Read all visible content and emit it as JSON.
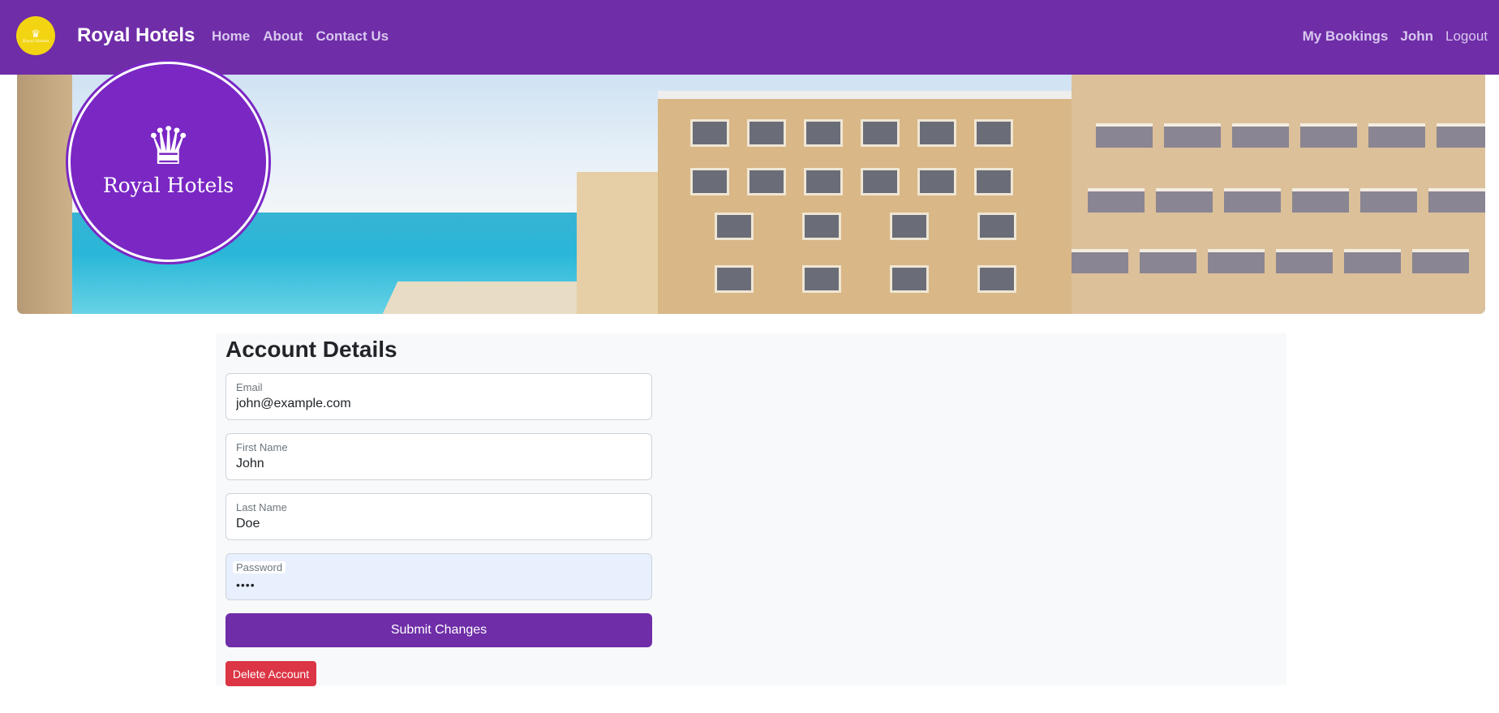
{
  "navbar": {
    "brand_name": "Royal Hotels",
    "logo_icon": "crown-icon",
    "logo_text": "Royal Hotels",
    "left_links": [
      "Home",
      "About",
      "Contact Us"
    ],
    "right_links": [
      "My Bookings",
      "John",
      "Logout"
    ],
    "background_color": "#6f2da8",
    "logo_color": "#f2d413"
  },
  "hero": {
    "emblem_icon": "crown-icon",
    "emblem_text": "Royal Hotels",
    "emblem_color": "#7a27c4"
  },
  "account": {
    "title": "Account Details",
    "fields": [
      {
        "label": "Email",
        "value": "john@example.com",
        "type": "email"
      },
      {
        "label": "First Name",
        "value": "John",
        "type": "text"
      },
      {
        "label": "Last Name",
        "value": "Doe",
        "type": "text"
      },
      {
        "label": "Password",
        "value": "••••",
        "type": "password"
      }
    ],
    "submit_label": "Submit Changes",
    "delete_label": "Delete Account",
    "submit_color": "#6f2da8",
    "delete_color": "#dc3545"
  }
}
